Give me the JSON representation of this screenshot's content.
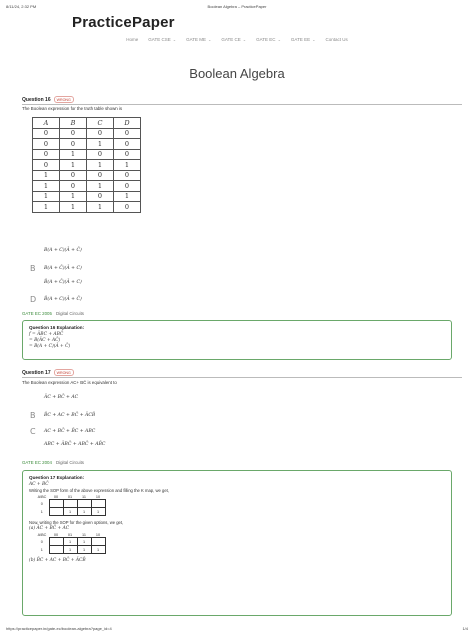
{
  "print_header": {
    "datetime": "8/11/24, 2:32 PM",
    "title": "Boolean Algebra – PracticePaper"
  },
  "site": {
    "title": "PracticePaper"
  },
  "nav": [
    {
      "label": "Home",
      "dropdown": false
    },
    {
      "label": "GATE CSE",
      "dropdown": true
    },
    {
      "label": "GATE ME",
      "dropdown": true
    },
    {
      "label": "GATE CE",
      "dropdown": true
    },
    {
      "label": "GATE EC",
      "dropdown": true
    },
    {
      "label": "GATE EE",
      "dropdown": true
    },
    {
      "label": "Contact Us",
      "dropdown": false
    }
  ],
  "page_title": "Boolean Algebra",
  "q16": {
    "label": "Question 16",
    "badge": "WRONG",
    "text": "The Boolean expression for the truth table shown is",
    "table": {
      "headers": [
        "A",
        "B",
        "C",
        "D"
      ],
      "rows": [
        [
          "0",
          "0",
          "0",
          "0"
        ],
        [
          "0",
          "0",
          "1",
          "0"
        ],
        [
          "0",
          "1",
          "0",
          "0"
        ],
        [
          "0",
          "1",
          "1",
          "1"
        ],
        [
          "1",
          "0",
          "0",
          "0"
        ],
        [
          "1",
          "0",
          "1",
          "0"
        ],
        [
          "1",
          "1",
          "0",
          "1"
        ],
        [
          "1",
          "1",
          "1",
          "0"
        ]
      ]
    },
    "options": [
      {
        "letter": "",
        "math": "B(A + C)(Ā + C̄)"
      },
      {
        "letter": "B",
        "math": "B(A + C̄)(Ā + C)"
      },
      {
        "letter": "",
        "math": "B̄(A + C̄)(Ā + C)"
      },
      {
        "letter": "D",
        "math": "B̄(A + C)(Ā + C̄)"
      }
    ],
    "tag": "GATE EC 2005",
    "topic": "Digital Circuits",
    "explanation": {
      "heading": "Question 16 Explanation:",
      "lines": [
        "f = ĀBC + ABC̄",
        "= B(ĀC + AC̄)",
        "= B(A + C)(Ā + C̄)"
      ]
    }
  },
  "q17": {
    "label": "Question 17",
    "badge": "WRONG",
    "text": "The Boolean expression AC+ BC̄ is equivalent to",
    "options": [
      {
        "letter": "",
        "math": "ĀC + BC̄ + AC"
      },
      {
        "letter": "B",
        "math": "B̄C + AC + BC̄ + ĀCB̄"
      },
      {
        "letter": "C",
        "math": "AC + BC̄ + B̄C + ABC"
      },
      {
        "letter": "",
        "math": "ABC + ĀBC̄ + ABC̄ + AB̄C"
      }
    ],
    "tag": "GATE EC 2004",
    "topic": "Digital Circuits",
    "explanation": {
      "heading": "Question 17 Explanation:",
      "expr": "AC + BC̄",
      "text1": "Writing the SOP form of the above expression and filling the K map, we get,",
      "kmap1_cols": [
        "00",
        "01",
        "11",
        "10"
      ],
      "kmap1_rows": [
        [
          "",
          "",
          "",
          ""
        ],
        [
          "",
          "1",
          "1",
          "1"
        ]
      ],
      "text2": "Now, writing the SOP for the given options, we get,",
      "opt_a": "(a) ĀC + BC̄ + AC",
      "kmap2_cols": [
        "00",
        "01",
        "11",
        "10"
      ],
      "kmap2_rows": [
        [
          "",
          "1",
          "1",
          ""
        ],
        [
          "",
          "1",
          "1",
          "1"
        ]
      ],
      "opt_b": "(b) B̄C + AC + BC̄ + ĀCB̄"
    }
  },
  "print_footer": {
    "url": "https://practicepaper.in/gate-ec/boolean-algebra?page_id=4",
    "page": "1/4"
  }
}
